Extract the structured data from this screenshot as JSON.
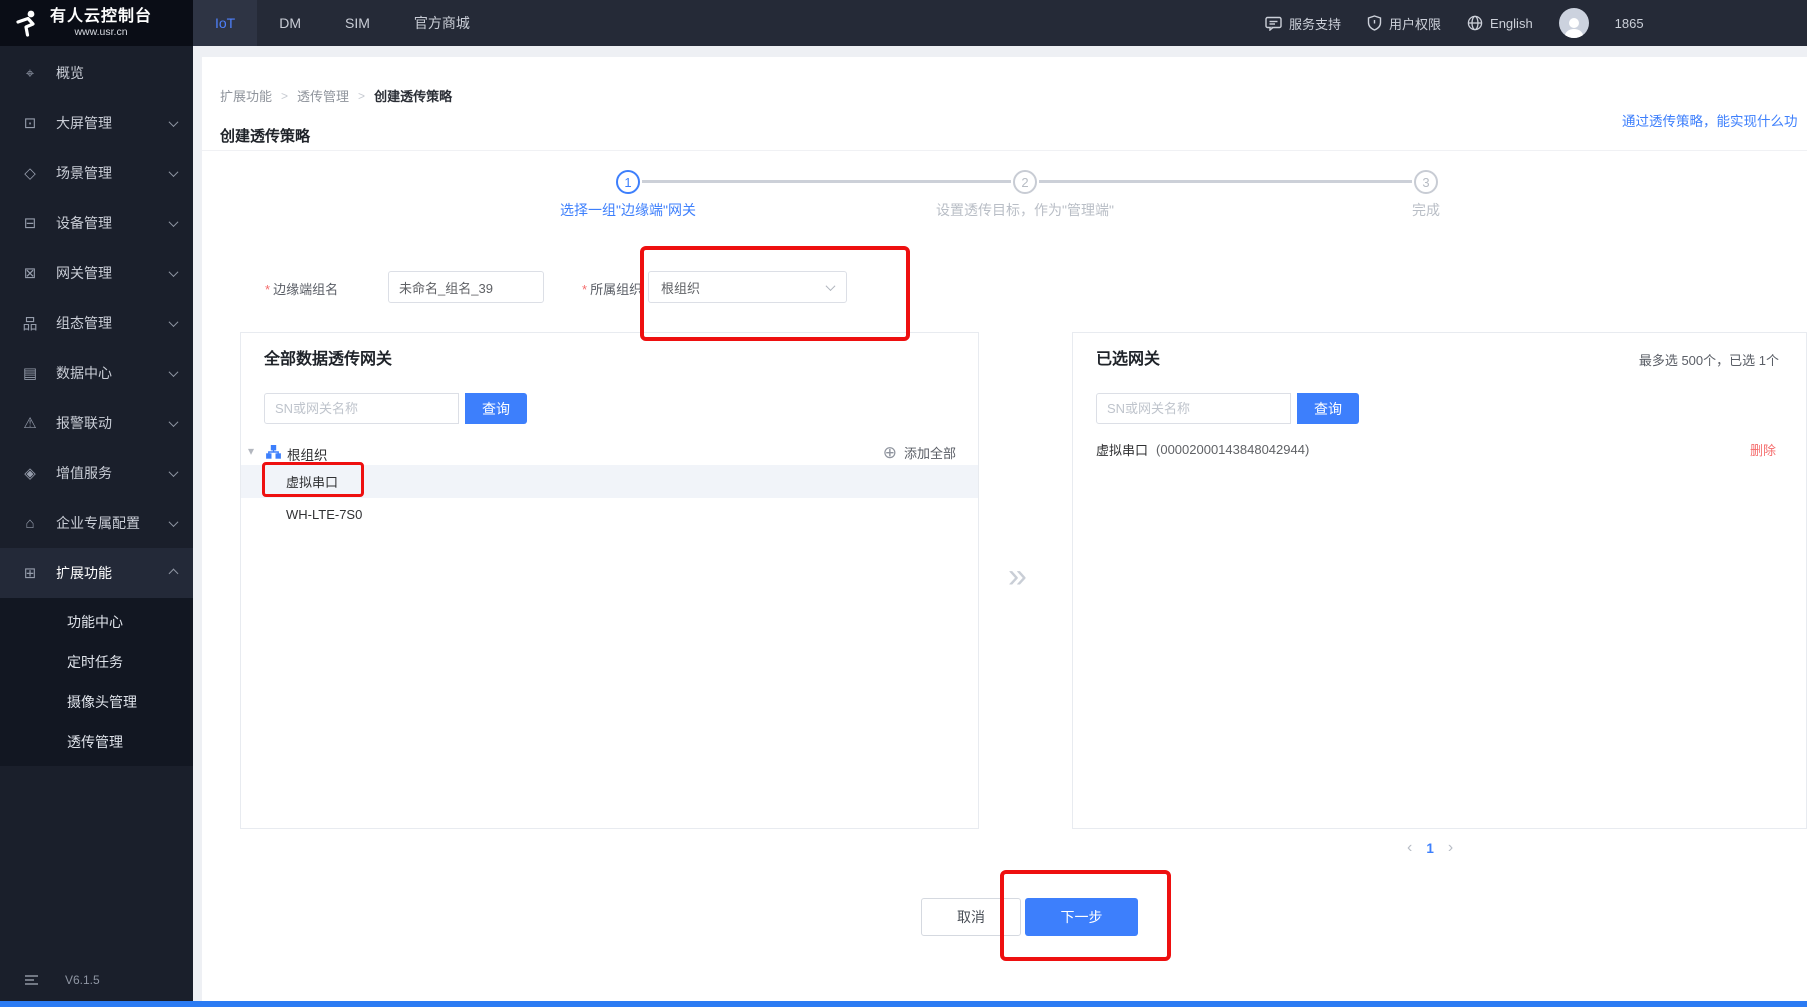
{
  "brand": {
    "title": "有人云控制台",
    "subtitle": "www.usr.cn"
  },
  "topbar": {
    "tabs": [
      {
        "label": "IoT"
      },
      {
        "label": "DM"
      },
      {
        "label": "SIM"
      },
      {
        "label": "官方商城"
      }
    ],
    "service_support": "服务支持",
    "user_rights": "用户权限",
    "language": "English",
    "account_number": "1865"
  },
  "sidebar": {
    "items": [
      {
        "icon": "overview-icon",
        "glyph": "⌖",
        "label": "概览"
      },
      {
        "icon": "screen-icon",
        "glyph": "⊡",
        "label": "大屏管理"
      },
      {
        "icon": "scene-icon",
        "glyph": "◇",
        "label": "场景管理"
      },
      {
        "icon": "device-icon",
        "glyph": "⊟",
        "label": "设备管理"
      },
      {
        "icon": "gateway-icon",
        "glyph": "⊠",
        "label": "网关管理"
      },
      {
        "icon": "configuration-icon",
        "glyph": "品",
        "label": "组态管理"
      },
      {
        "icon": "data-center-icon",
        "glyph": "▤",
        "label": "数据中心"
      },
      {
        "icon": "alarm-icon",
        "glyph": "⚠",
        "label": "报警联动"
      },
      {
        "icon": "value-added-icon",
        "glyph": "◈",
        "label": "增值服务"
      },
      {
        "icon": "enterprise-icon",
        "glyph": "⌂",
        "label": "企业专属配置"
      },
      {
        "icon": "extension-icon",
        "glyph": "⊞",
        "label": "扩展功能"
      }
    ],
    "submenu": [
      {
        "label": "功能中心"
      },
      {
        "label": "定时任务"
      },
      {
        "label": "摄像头管理"
      },
      {
        "label": "透传管理"
      }
    ],
    "version": "V6.1.5"
  },
  "breadcrumb": {
    "separator": ">",
    "items": [
      {
        "label": "扩展功能"
      },
      {
        "label": "透传管理"
      },
      {
        "label": "创建透传策略"
      }
    ]
  },
  "page": {
    "title": "创建透传策略",
    "help_link": "通过透传策略，能实现什么功"
  },
  "steps": [
    {
      "num": "1",
      "label": "选择一组\"边缘端\"网关"
    },
    {
      "num": "2",
      "label": "设置透传目标，作为\"管理端\""
    },
    {
      "num": "3",
      "label": "完成"
    }
  ],
  "form": {
    "group_label": "边缘端组名",
    "group_value": "未命名_组名_39",
    "org_label": "所属组织",
    "org_value": "根组织"
  },
  "left_panel": {
    "title": "全部数据透传网关",
    "search_placeholder": "SN或网关名称",
    "search_button": "查询",
    "root_org": "根组织",
    "add_all": "添加全部",
    "gateways": [
      {
        "name": "虚拟串口"
      },
      {
        "name": "WH-LTE-7S0"
      }
    ]
  },
  "right_panel": {
    "title": "已选网关",
    "limit_text": "最多选 500个，已选 1个",
    "search_placeholder": "SN或网关名称",
    "search_button": "查询",
    "selected": [
      {
        "name": "虚拟串口",
        "sn": "(00002000143848042944)",
        "delete_label": "删除"
      }
    ],
    "pagination": {
      "current": "1"
    }
  },
  "footer": {
    "cancel": "取消",
    "next": "下一步"
  },
  "colors": {
    "primary": "#3d7ffc",
    "danger": "#f56c6c",
    "annotation": "#ee1010"
  }
}
